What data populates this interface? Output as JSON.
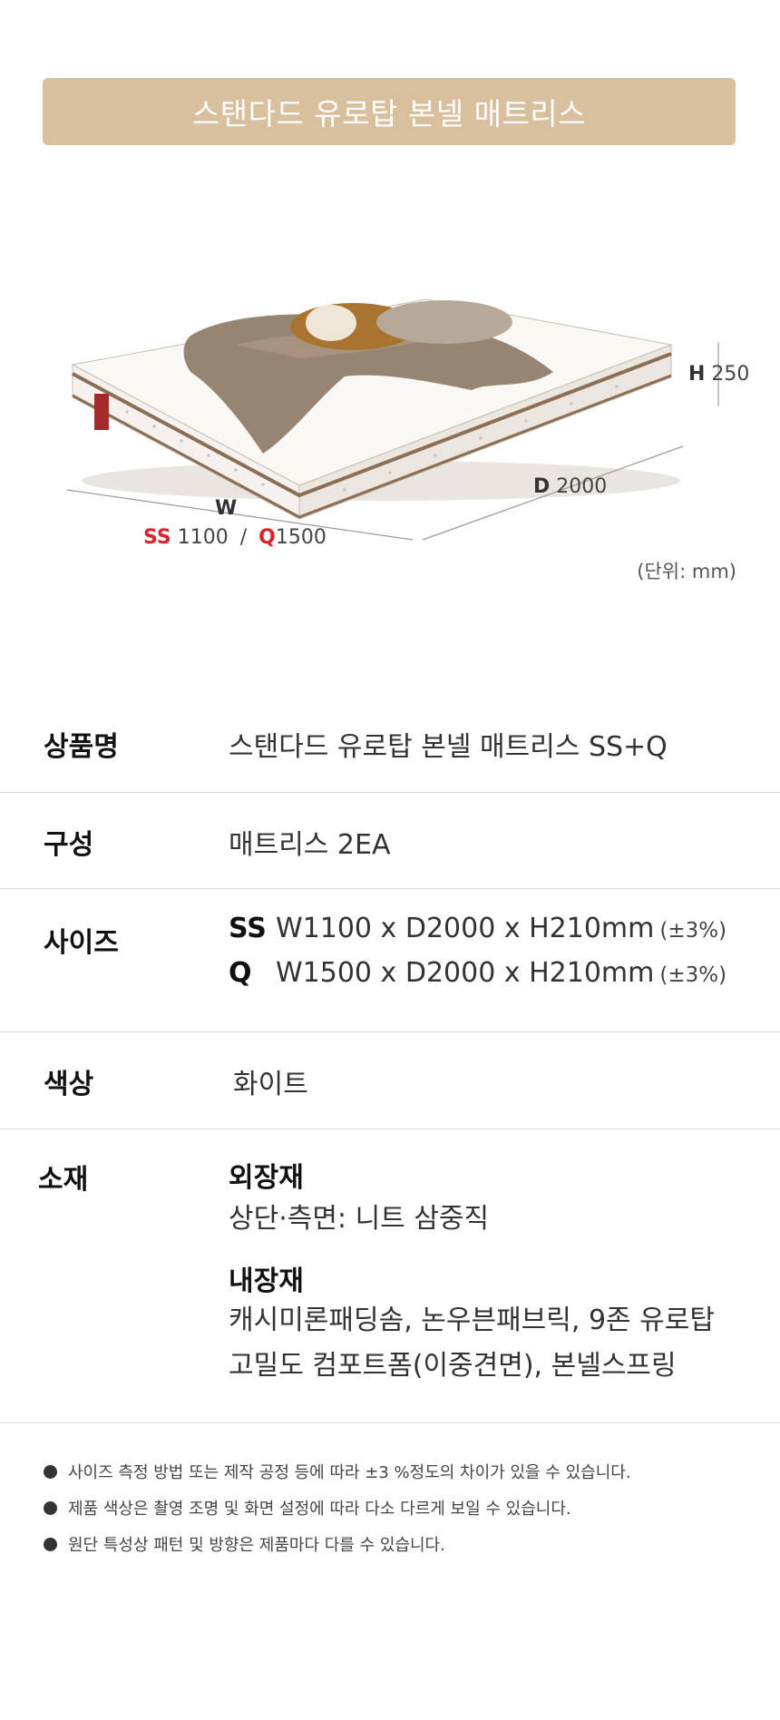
{
  "title": "스탠다드 유로탑 본넬 매트리스",
  "dimensions": {
    "w_label": "W",
    "w_ss_key": "SS",
    "w_ss_value": "1100",
    "w_sep": "/",
    "w_q_key": "Q",
    "w_q_value": "1500",
    "d_key": "D",
    "d_value": "2000",
    "h_key": "H",
    "h_value": "250",
    "unit": "(단위: mm)"
  },
  "specs": {
    "name": {
      "label": "상품명",
      "value": "스탠다드 유로탑 본넬 매트리스 SS+Q"
    },
    "composition": {
      "label": "구성",
      "value": "매트리스 2EA"
    },
    "size": {
      "label": "사이즈",
      "rows": [
        {
          "key": "SS",
          "value": "W1100 x D2000 x H210mm",
          "tolerance": "(±3%)"
        },
        {
          "key": "Q",
          "value": "W1500 x D2000 x H210mm",
          "tolerance": "(±3%)"
        }
      ]
    },
    "color": {
      "label": "색상",
      "value": "화이트"
    },
    "material": {
      "label": "소재",
      "outer_title": "외장재",
      "outer_text": "상단·측면: 니트 삼중직",
      "inner_title": "내장재",
      "inner_line1": "캐시미론패딩솜, 논우븐패브릭, 9존 유로탑",
      "inner_line2": "고밀도 컴포트폼(이중견면), 본넬스프링"
    }
  },
  "notes": [
    "사이즈 측정 방법 또는 제작 공정 등에 따라 ±3 %정도의 차이가 있을 수 있습니다.",
    "제품 색상은 촬영 조명 및 화면 설정에 따라 다소 다르게 보일 수 있습니다.",
    "원단 특성상 패턴 및 방향은 제품마다 다를 수 있습니다."
  ],
  "colors": {
    "title_bar": "#d8bf9d",
    "accent_red": "#d8262b",
    "divider": "#d9d9d9"
  }
}
